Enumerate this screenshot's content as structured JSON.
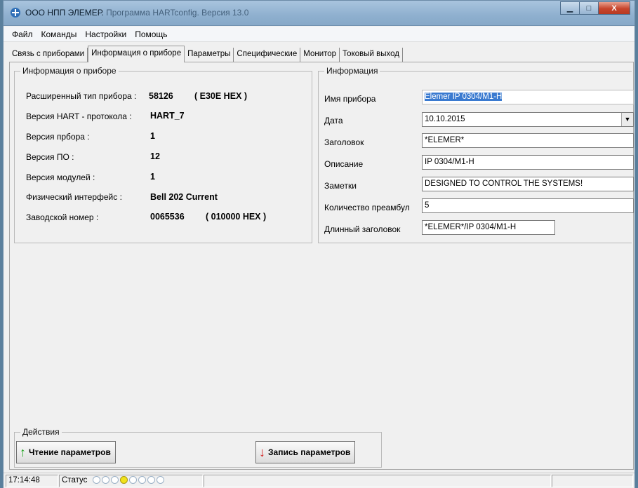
{
  "window": {
    "title_main": "ООО НПП ЭЛЕМЕР.",
    "title_rest": "Программа HARTconfig. Версия 13.0",
    "minimize_glyph": "▁",
    "maximize_glyph": "□",
    "close_glyph": "X"
  },
  "menu": [
    "Файл",
    "Команды",
    "Настройки",
    "Помощь"
  ],
  "tabs": [
    "Связь с приборами",
    "Информация о приборе",
    "Параметры",
    "Специфические",
    "Монитор",
    "Токовый выход"
  ],
  "device_info": {
    "legend": "Информация о приборе",
    "rows": [
      {
        "label": "Расширенный тип прибора :",
        "value": "58126",
        "hex": "( E30E HEX )"
      },
      {
        "label": "Версия HART - протокола :",
        "value": "HART_7",
        "hex": ""
      },
      {
        "label": "Версия прбора :",
        "value": "1",
        "hex": ""
      },
      {
        "label": "Версия ПО :",
        "value": "12",
        "hex": ""
      },
      {
        "label": "Версия модулей :",
        "value": "1",
        "hex": ""
      },
      {
        "label": "Физический интерфейс :",
        "value": "Bell 202 Current",
        "hex": ""
      },
      {
        "label": "Заводской номер :",
        "value": "0065536",
        "hex": "( 010000 HEX )"
      }
    ]
  },
  "info_form": {
    "legend": "Информация",
    "fields": [
      {
        "label": "Имя прибора",
        "value": "Elemer IP 0304/M1-H"
      },
      {
        "label": "Дата",
        "value": "10.10.2015"
      },
      {
        "label": "Заголовок",
        "value": "*ELEMER*"
      },
      {
        "label": "Описание",
        "value": "IP 0304/M1-H"
      },
      {
        "label": "Заметки",
        "value": "DESIGNED TO CONTROL THE SYSTEMS!"
      },
      {
        "label": "Количество преамбул",
        "value": "5"
      },
      {
        "label": "Длинный заголовок",
        "value": "*ELEMER*/IP 0304/M1-H"
      }
    ]
  },
  "actions": {
    "legend": "Действия",
    "read_label": "Чтение параметров",
    "write_label": "Запись параметров",
    "read_icon": "green-up-arrow-icon",
    "write_icon": "red-down-arrow-icon"
  },
  "status": {
    "time": "17:14:48",
    "label": "Статус",
    "indicator_count": 8,
    "active_indicator": 4
  },
  "colors": {
    "read_arrow": "#1fa31f",
    "write_arrow": "#d21414",
    "selection": "#3a7ad0",
    "indicator_on": "#f1e21a"
  }
}
